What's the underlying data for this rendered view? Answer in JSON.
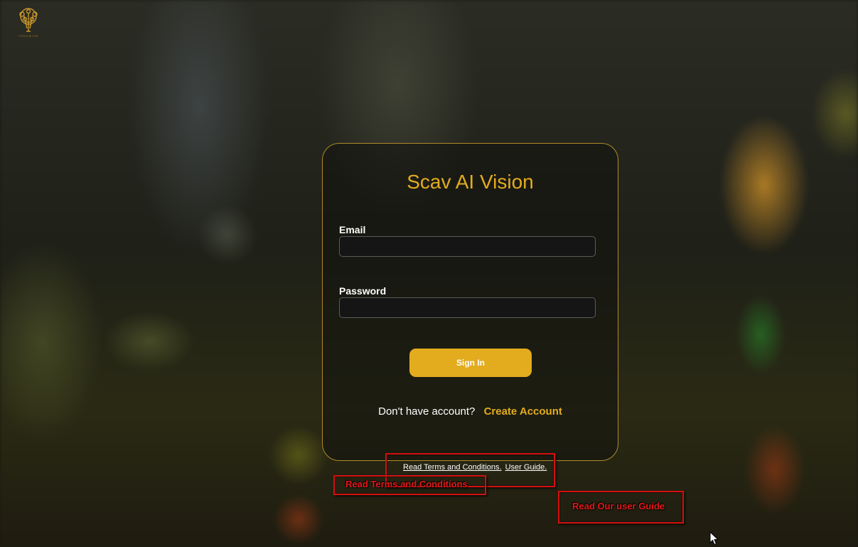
{
  "app": {
    "title": "Scav AI Vision",
    "logo_icon": "tree-circuit-icon",
    "logo_caption": "TREEWISE"
  },
  "form": {
    "email_label": "Email",
    "email_value": "",
    "email_placeholder": "",
    "password_label": "Password",
    "password_value": "",
    "password_placeholder": "",
    "signin_label": "Sign In"
  },
  "signup": {
    "question": "Don't have account?",
    "link_label": "Create Account"
  },
  "footer": {
    "terms_link": "Read Terms and Conditions.",
    "guide_link": "User Guide."
  },
  "annotations": {
    "terms_note": "Read Terms and Conditions",
    "guide_note": "Read Our user Guide"
  },
  "colors": {
    "accent": "#e3ac1e",
    "annotation": "#d41010"
  }
}
